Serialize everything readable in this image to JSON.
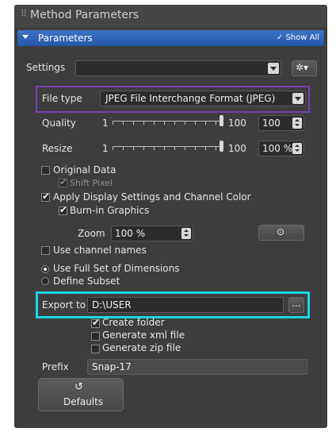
{
  "panel": {
    "title": "Method Parameters",
    "grip_icon": "grip-icon",
    "section": {
      "label": "Parameters",
      "show_all": "Show All"
    }
  },
  "settings": {
    "label": "Settings",
    "value": ""
  },
  "file_type": {
    "label": "File type",
    "value": "JPEG File Interchange Format (JPEG)"
  },
  "quality": {
    "label": "Quality",
    "min": "1",
    "max": "100",
    "value": "100",
    "level": 1.0
  },
  "resize": {
    "label": "Resize",
    "min": "1",
    "max": "100",
    "value": "100 %",
    "level": 1.0
  },
  "options": {
    "original_data": {
      "label": "Original Data",
      "checked": false
    },
    "shift_pixel": {
      "label": "Shift Pixel",
      "checked": true,
      "enabled": false
    },
    "apply_display": {
      "label": "Apply Display Settings and Channel Color",
      "checked": true
    },
    "burn_in": {
      "label": "Burn-in Graphics",
      "checked": true
    }
  },
  "zoom": {
    "label": "Zoom",
    "value": "100 %"
  },
  "use_channel_names": {
    "label": "Use channel names",
    "checked": false
  },
  "dimensions": {
    "full_set": {
      "label": "Use Full Set of Dimensions",
      "selected": true
    },
    "subset": {
      "label": "Define Subset",
      "selected": false
    }
  },
  "export": {
    "label": "Export to",
    "path": "D:\\USER",
    "browse": "...",
    "create_folder": {
      "label": "Create folder",
      "checked": true
    },
    "generate_xml": {
      "label": "Generate xml file",
      "checked": false
    },
    "generate_zip": {
      "label": "Generate zip file",
      "checked": false
    }
  },
  "prefix": {
    "label": "Prefix",
    "value": "Snap-17"
  },
  "defaults_button": {
    "label": "Defaults",
    "icon": "undo-icon"
  },
  "colors": {
    "panel_bg": "#3d3d3d",
    "accent_blue": "#2f66b8",
    "highlight_purple": "#7a3fb8",
    "highlight_cyan": "#19d6e6"
  }
}
